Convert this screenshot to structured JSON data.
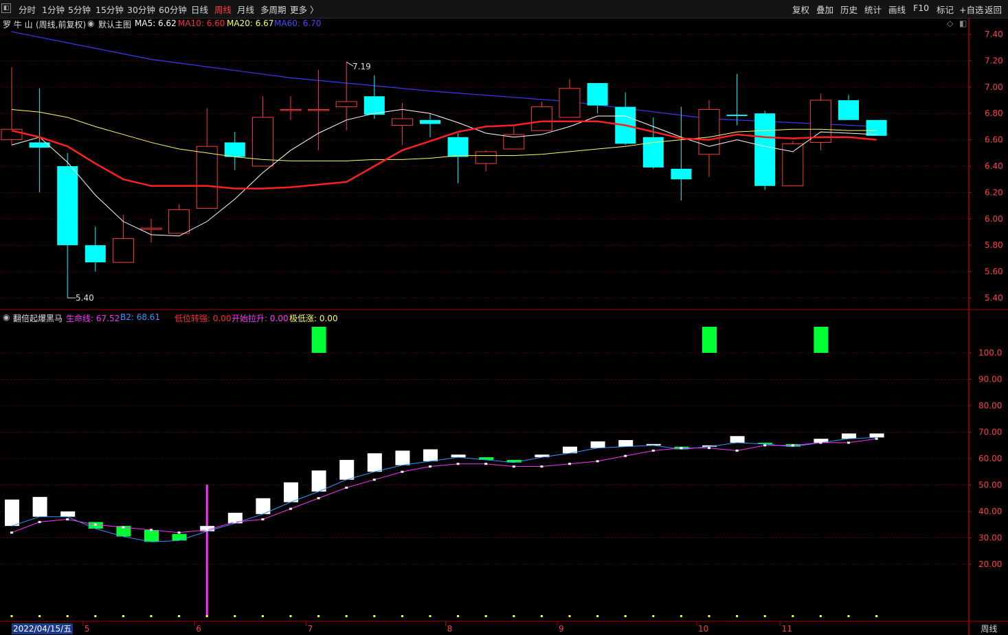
{
  "toolbar": {
    "periods": [
      "分时",
      "1分钟",
      "5分钟",
      "15分钟",
      "30分钟",
      "60分钟",
      "日线",
      "周线",
      "月线",
      "多周期",
      "更多 〉"
    ],
    "active_period": "周线",
    "right_buttons": [
      "复权",
      "叠加",
      "历史",
      "统计",
      "画线",
      "F10",
      "标记",
      "+自选",
      "返回"
    ]
  },
  "main_legend": {
    "stock": "罗 牛 山",
    "mode": "(周线,前复权)",
    "template": "默认主图",
    "ma5": "MA5: 6.62",
    "ma10": "MA10: 6.60",
    "ma20": "MA20: 6.67",
    "ma60": "MA60: 6.70"
  },
  "sub_legend": {
    "name": "翻倍起爆黑马",
    "life_line": "生命线: 67.52",
    "b2": "B2: 68.61",
    "low_strong": "低位转强: 0.00",
    "start_rise": "开始拉升: 0.00",
    "extreme_low": "极低涨: 0.00"
  },
  "annotations": {
    "high": "7.19",
    "low": "5.40"
  },
  "bottom": {
    "date": "2022/04/15/五",
    "mode": "周线"
  },
  "colors": {
    "up": "#ff3b3b",
    "down": "#00ffff",
    "ma5": "#ffffff",
    "ma10": "#ff2020",
    "ma20": "#ffff66",
    "ma60": "#3a3aff",
    "lifeline": "#ff33ff",
    "b2": "#3399ff",
    "signal": "#00ff33",
    "axis": "#b00000"
  },
  "chart_data": {
    "type": "candlestick",
    "price_axis": {
      "ticks": [
        "7.40",
        "7.20",
        "7.00",
        "6.80",
        "6.60",
        "6.40",
        "6.20",
        "6.00",
        "5.80",
        "5.60",
        "5.40"
      ],
      "range": [
        5.35,
        7.5
      ]
    },
    "sub_axis": {
      "ticks": [
        "100.0",
        "90.00",
        "80.00",
        "70.00",
        "60.00",
        "50.00",
        "40.00",
        "30.00",
        "20.00"
      ],
      "range": [
        0,
        115
      ]
    },
    "x_labels": [
      {
        "text": "5",
        "index": 3
      },
      {
        "text": "6",
        "index": 7
      },
      {
        "text": "7",
        "index": 11
      },
      {
        "text": "8",
        "index": 16
      },
      {
        "text": "9",
        "index": 20
      },
      {
        "text": "10",
        "index": 25
      },
      {
        "text": "11",
        "index": 28
      }
    ],
    "candles": [
      {
        "o": 6.6,
        "h": 7.15,
        "l": 6.56,
        "c": 6.68
      },
      {
        "o": 6.58,
        "h": 6.99,
        "l": 6.2,
        "c": 6.54
      },
      {
        "o": 6.4,
        "h": 6.5,
        "l": 5.4,
        "c": 5.8
      },
      {
        "o": 5.8,
        "h": 5.94,
        "l": 5.6,
        "c": 5.67
      },
      {
        "o": 5.67,
        "h": 6.03,
        "l": 5.67,
        "c": 5.85
      },
      {
        "o": 5.92,
        "h": 6.0,
        "l": 5.82,
        "c": 5.93
      },
      {
        "o": 5.89,
        "h": 6.11,
        "l": 5.89,
        "c": 6.07
      },
      {
        "o": 6.08,
        "h": 6.84,
        "l": 6.08,
        "c": 6.55
      },
      {
        "o": 6.58,
        "h": 6.66,
        "l": 6.37,
        "c": 6.47
      },
      {
        "o": 6.4,
        "h": 6.93,
        "l": 6.4,
        "c": 6.77
      },
      {
        "o": 6.83,
        "h": 6.93,
        "l": 6.75,
        "c": 6.83
      },
      {
        "o": 6.83,
        "h": 7.13,
        "l": 6.52,
        "c": 6.83
      },
      {
        "o": 6.85,
        "h": 7.19,
        "l": 6.67,
        "c": 6.89
      },
      {
        "o": 6.93,
        "h": 7.09,
        "l": 6.76,
        "c": 6.79
      },
      {
        "o": 6.71,
        "h": 6.88,
        "l": 6.56,
        "c": 6.76
      },
      {
        "o": 6.75,
        "h": 6.8,
        "l": 6.62,
        "c": 6.72
      },
      {
        "o": 6.62,
        "h": 6.65,
        "l": 6.27,
        "c": 6.47
      },
      {
        "o": 6.42,
        "h": 6.52,
        "l": 6.36,
        "c": 6.51
      },
      {
        "o": 6.53,
        "h": 6.7,
        "l": 6.53,
        "c": 6.64
      },
      {
        "o": 6.67,
        "h": 6.89,
        "l": 6.67,
        "c": 6.85
      },
      {
        "o": 6.77,
        "h": 7.06,
        "l": 6.77,
        "c": 6.99
      },
      {
        "o": 7.03,
        "h": 7.03,
        "l": 6.8,
        "c": 6.86
      },
      {
        "o": 6.85,
        "h": 6.96,
        "l": 6.56,
        "c": 6.57
      },
      {
        "o": 6.62,
        "h": 6.77,
        "l": 6.38,
        "c": 6.39
      },
      {
        "o": 6.38,
        "h": 6.85,
        "l": 6.14,
        "c": 6.3
      },
      {
        "o": 6.49,
        "h": 6.9,
        "l": 6.32,
        "c": 6.83
      },
      {
        "o": 6.79,
        "h": 7.1,
        "l": 6.71,
        "c": 6.78
      },
      {
        "o": 6.8,
        "h": 6.82,
        "l": 6.22,
        "c": 6.25
      },
      {
        "o": 6.25,
        "h": 6.59,
        "l": 6.25,
        "c": 6.57
      },
      {
        "o": 6.58,
        "h": 6.95,
        "l": 6.52,
        "c": 6.9
      },
      {
        "o": 6.9,
        "h": 6.94,
        "l": 6.76,
        "c": 6.75
      },
      {
        "o": 6.75,
        "h": 6.75,
        "l": 6.63,
        "c": 6.63
      }
    ],
    "ma5": [
      6.56,
      6.62,
      6.43,
      6.18,
      5.98,
      5.88,
      5.87,
      5.98,
      6.15,
      6.35,
      6.52,
      6.65,
      6.75,
      6.8,
      6.83,
      6.8,
      6.73,
      6.65,
      6.62,
      6.64,
      6.7,
      6.78,
      6.78,
      6.7,
      6.62,
      6.55,
      6.6,
      6.55,
      6.51,
      6.66,
      6.65,
      6.64
    ],
    "ma10": [
      6.67,
      6.62,
      6.55,
      6.42,
      6.3,
      6.25,
      6.25,
      6.25,
      6.23,
      6.23,
      6.24,
      6.26,
      6.28,
      6.4,
      6.52,
      6.59,
      6.66,
      6.7,
      6.71,
      6.74,
      6.74,
      6.74,
      6.71,
      6.66,
      6.61,
      6.6,
      6.64,
      6.62,
      6.61,
      6.62,
      6.62,
      6.6
    ],
    "ma20": [
      6.83,
      6.81,
      6.77,
      6.7,
      6.64,
      6.58,
      6.53,
      6.5,
      6.47,
      6.45,
      6.44,
      6.44,
      6.44,
      6.45,
      6.45,
      6.46,
      6.48,
      6.48,
      6.48,
      6.49,
      6.51,
      6.53,
      6.55,
      6.58,
      6.6,
      6.62,
      6.66,
      6.67,
      6.68,
      6.68,
      6.67,
      6.67
    ],
    "ma60_points": [
      [
        0,
        7.42
      ],
      [
        5,
        7.21
      ],
      [
        10,
        7.07
      ],
      [
        15,
        6.97
      ],
      [
        20,
        6.89
      ],
      [
        25,
        6.76
      ],
      [
        31,
        6.7
      ]
    ],
    "lifeline": [
      32,
      36,
      37,
      35,
      34,
      33,
      32,
      33,
      36,
      37,
      41,
      45,
      49,
      52,
      55,
      57,
      58,
      58,
      57,
      57,
      58,
      59,
      61,
      63,
      64,
      64,
      63,
      65,
      65,
      66,
      66,
      67.5
    ],
    "b2_blocks": [
      {
        "o": 34.5,
        "c": 44.5
      },
      {
        "o": 38.0,
        "c": 45.5
      },
      {
        "o": 38.0,
        "c": 40.0
      },
      {
        "o": 36.0,
        "c": 33.5
      },
      {
        "o": 34.5,
        "c": 30.5
      },
      {
        "o": 33.0,
        "c": 28.5
      },
      {
        "o": 31.5,
        "c": 29.0
      },
      {
        "o": 32.5,
        "c": 34.5
      },
      {
        "o": 35.5,
        "c": 39.5
      },
      {
        "o": 39.0,
        "c": 45.0
      },
      {
        "o": 43.5,
        "c": 51.0
      },
      {
        "o": 47.5,
        "c": 55.5
      },
      {
        "o": 52.0,
        "c": 59.5
      },
      {
        "o": 55.0,
        "c": 62.0
      },
      {
        "o": 57.5,
        "c": 63.0
      },
      {
        "o": 59.0,
        "c": 63.5
      },
      {
        "o": 60.5,
        "c": 61.5
      },
      {
        "o": 60.5,
        "c": 59.5
      },
      {
        "o": 59.5,
        "c": 58.5
      },
      {
        "o": 60.5,
        "c": 61.5
      },
      {
        "o": 62.0,
        "c": 64.5
      },
      {
        "o": 64.0,
        "c": 66.5
      },
      {
        "o": 64.5,
        "c": 67.0
      },
      {
        "o": 65.0,
        "c": 65.5
      },
      {
        "o": 64.5,
        "c": 63.5
      },
      {
        "o": 64.5,
        "c": 65.0
      },
      {
        "o": 66.0,
        "c": 68.5
      },
      {
        "o": 66.0,
        "c": 65.5
      },
      {
        "o": 65.5,
        "c": 64.5
      },
      {
        "o": 66.0,
        "c": 67.5
      },
      {
        "o": 67.5,
        "c": 69.5
      },
      {
        "o": 68.0,
        "c": 69.5
      }
    ],
    "signals": [
      11,
      25,
      29
    ],
    "spike_index": 7
  }
}
